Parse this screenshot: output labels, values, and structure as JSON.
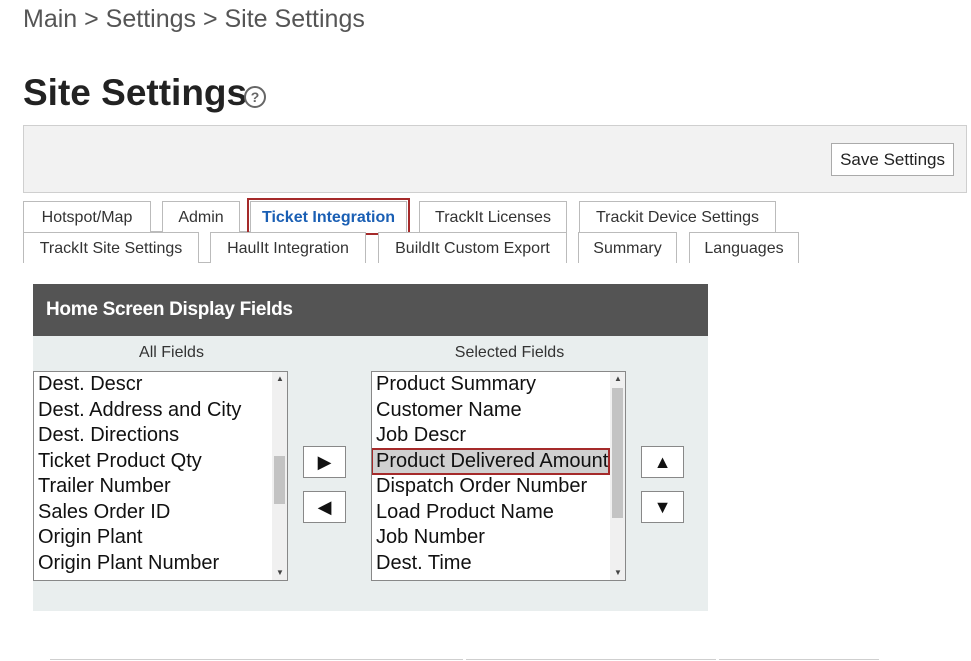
{
  "breadcrumb": "Main > Settings > Site Settings",
  "page_title": "Site Settings",
  "help_icon_glyph": "?",
  "toolbar": {
    "save_label": "Save Settings"
  },
  "tabs_row1": [
    "Hotspot/Map",
    "Admin",
    "Ticket Integration",
    "TrackIt Licenses",
    "Trackit Device Settings"
  ],
  "tabs_row2": [
    "TrackIt Site Settings",
    "HaulIt Integration",
    "BuildIt Custom Export",
    "Summary",
    "Languages"
  ],
  "active_tab": "Ticket Integration",
  "panel": {
    "title": "Home Screen Display Fields",
    "all_fields_label": "All Fields",
    "selected_fields_label": "Selected Fields",
    "all_fields": [
      "Dest. Descr",
      "Dest. Address and City",
      "Dest. Directions",
      "Ticket Product Qty",
      "Trailer Number",
      "Sales Order ID",
      "Origin Plant",
      "Origin Plant Number"
    ],
    "selected_fields": [
      "Product Summary",
      "Customer Name",
      "Job Descr",
      "Product Delivered Amount",
      "Dispatch Order Number",
      "Load Product Name",
      "Job Number",
      "Dest. Time"
    ],
    "selected_item": "Product Delivered Amount",
    "buttons": {
      "add": "▶",
      "remove": "◀",
      "up": "▲",
      "down": "▼"
    }
  },
  "colors": {
    "active_tab_text": "#1a5fb4",
    "highlight_border": "#a52a2a",
    "panel_header": "#545454",
    "panel_bg": "#e9eeee"
  }
}
